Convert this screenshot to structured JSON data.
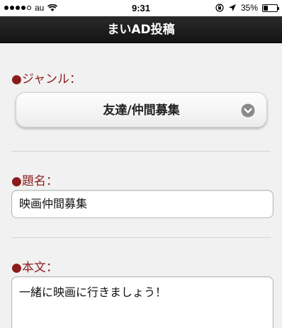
{
  "status_bar": {
    "carrier": "au",
    "time": "9:31",
    "battery_percent": "35%",
    "battery_level": 0.35,
    "signal_bars": 4
  },
  "nav": {
    "title": "まいAD投稿"
  },
  "form": {
    "genre": {
      "label": "●ジャンル：",
      "value": "友達/仲間募集"
    },
    "title": {
      "label": "●題名：",
      "value": "映画仲間募集"
    },
    "body": {
      "label": "●本文：",
      "value": "一緒に映画に行きましょう！"
    }
  },
  "colors": {
    "label": "#8c1b1b",
    "nav_bg": "#1a1a1a",
    "page_bg": "#f1f1f1"
  }
}
